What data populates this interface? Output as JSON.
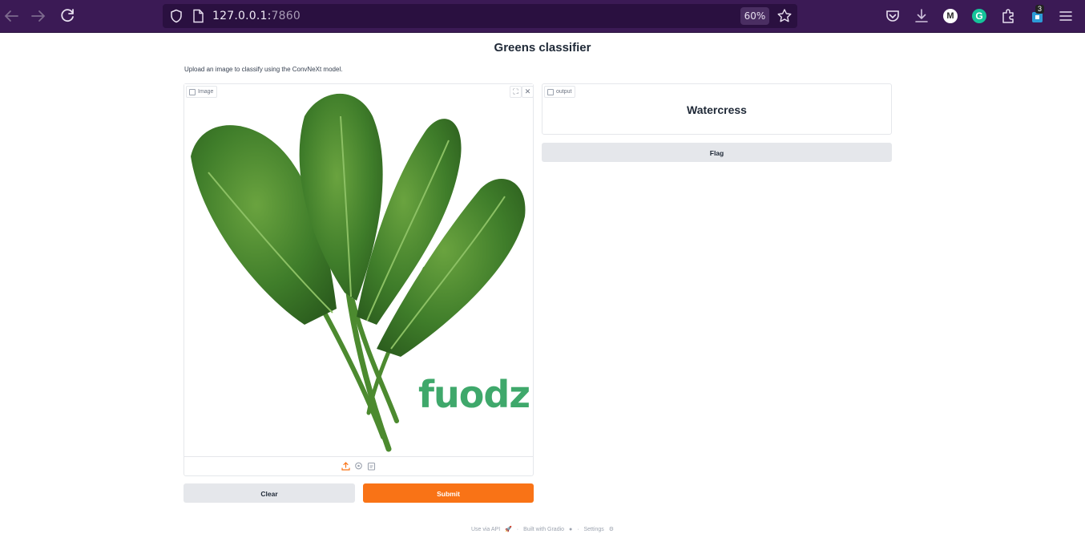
{
  "browser": {
    "url_host": "127.0.0.1:",
    "url_port": "7860",
    "zoom": "60%",
    "extension_count": "3",
    "avatar_letter": "M",
    "grammarly_letter": "G"
  },
  "page": {
    "title": "Greens classifier",
    "description": "Upload an image to classify using the ConvNeXt model."
  },
  "input_panel": {
    "label": "Image",
    "watermark": "fuodz",
    "clear_label": "Clear",
    "submit_label": "Submit"
  },
  "output_panel": {
    "label": "output",
    "value": "Watercress",
    "flag_label": "Flag"
  },
  "footer": {
    "api": "Use via API",
    "built": "Built with Gradio",
    "settings": "Settings",
    "sep": "·"
  },
  "colors": {
    "accent": "#f97316",
    "chrome": "#3b1a55",
    "watermark_green": "#3fa86b",
    "watermark_teal": "#138a8a"
  }
}
